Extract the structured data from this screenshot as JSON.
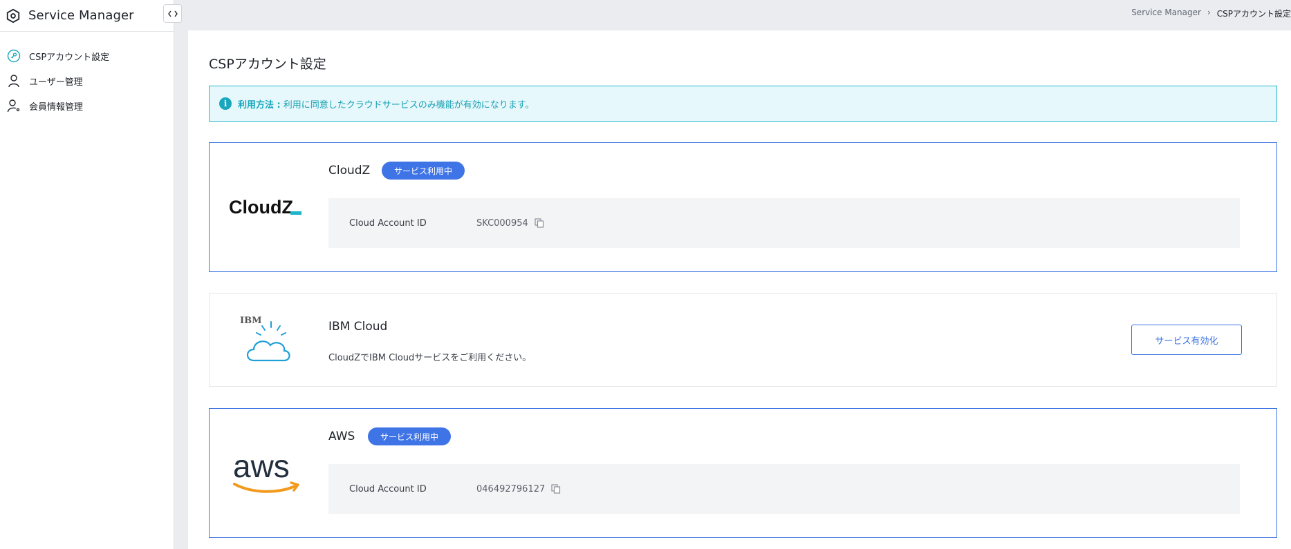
{
  "app": {
    "title": "Service Manager"
  },
  "sidebar": {
    "items": [
      {
        "label": "CSPアカウント設定",
        "icon": "key-icon",
        "active": true
      },
      {
        "label": "ユーザー管理",
        "icon": "user-icon",
        "active": false
      },
      {
        "label": "会員情報管理",
        "icon": "user-gear-icon",
        "active": false
      }
    ]
  },
  "breadcrumb": {
    "root": "Service Manager",
    "separator": "›",
    "current": "CSPアカウント設定"
  },
  "page": {
    "title": "CSPアカウント設定"
  },
  "notice": {
    "label": "利用方法 :",
    "text": "利用に同意したクラウドサービスのみ機能が有効になります。"
  },
  "services": [
    {
      "name": "CloudZ",
      "logo_text": "CloudZ",
      "badge": "サービス利用中",
      "id_label": "Cloud Account ID",
      "id_value": "SKC000954"
    },
    {
      "name": "IBM Cloud",
      "logo_text": "IBM",
      "description": "CloudZでIBM Cloudサービスをご利用ください。",
      "button": "サービス有効化"
    },
    {
      "name": "AWS",
      "logo_text": "aws",
      "badge": "サービス利用中",
      "id_label": "Cloud Account ID",
      "id_value": "046492796127"
    }
  ],
  "colors": {
    "accent": "#3f74e7",
    "notice_border": "#1fb6c8",
    "notice_bg": "#e6f8fb",
    "aws_orange": "#f29a1c"
  }
}
